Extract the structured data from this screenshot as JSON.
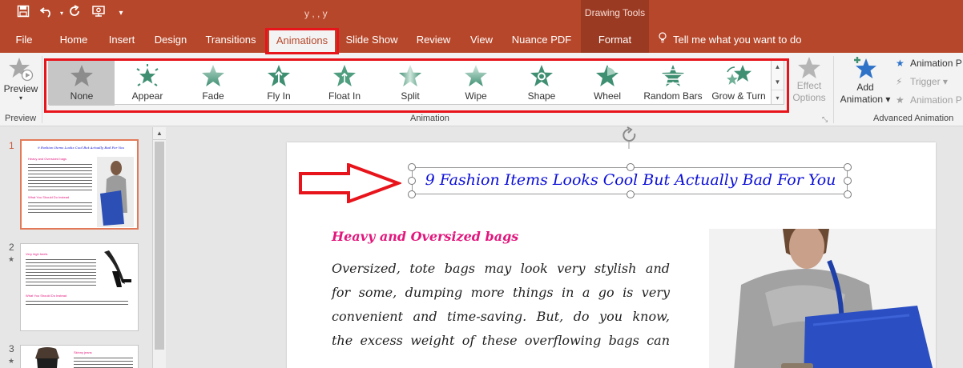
{
  "title_bar": {
    "document_title": "y                    ,   ,         y",
    "contextual_tab_group": "Drawing Tools",
    "quick_access": [
      "save-icon",
      "undo-icon",
      "redo-icon",
      "present-icon",
      "customize-icon"
    ]
  },
  "tabs": [
    {
      "label": "File"
    },
    {
      "label": "Home"
    },
    {
      "label": "Insert"
    },
    {
      "label": "Design"
    },
    {
      "label": "Transitions"
    },
    {
      "label": "Animations",
      "active": true
    },
    {
      "label": "Slide Show"
    },
    {
      "label": "Review"
    },
    {
      "label": "View"
    },
    {
      "label": "Nuance PDF"
    },
    {
      "label": "Format"
    }
  ],
  "tell_me": "Tell me what you want to do",
  "ribbon": {
    "preview": {
      "label": "Preview",
      "group": "Preview"
    },
    "animation_group": "Animation",
    "animations": [
      {
        "label": "None",
        "selected": true
      },
      {
        "label": "Appear"
      },
      {
        "label": "Fade"
      },
      {
        "label": "Fly In"
      },
      {
        "label": "Float In"
      },
      {
        "label": "Split"
      },
      {
        "label": "Wipe"
      },
      {
        "label": "Shape"
      },
      {
        "label": "Wheel"
      },
      {
        "label": "Random Bars"
      },
      {
        "label": "Grow & Turn"
      }
    ],
    "effect_options": {
      "line1": "Effect",
      "line2": "Options"
    },
    "add_animation": {
      "line1": "Add",
      "line2": "Animation"
    },
    "advanced_group": "Advanced Animation",
    "advanced_items": [
      {
        "label": "Animation P",
        "enabled": true
      },
      {
        "label": "Trigger",
        "enabled": false
      },
      {
        "label": "Animation P",
        "enabled": false
      }
    ]
  },
  "slides": [
    {
      "number": "1",
      "active": true,
      "title": "9 Fashion Items Looks Cool But Actually Bad For You",
      "heading": "Heavy and Oversized bags",
      "subheading": "What You Should Do Instead"
    },
    {
      "number": "2",
      "has_animation": true,
      "heading": "Very high heels",
      "subheading": "What You Should Do Instead"
    },
    {
      "number": "3",
      "has_animation": true,
      "heading": "Skinny jeans"
    }
  ],
  "slide": {
    "title": "9 Fashion Items Looks Cool But Actually Bad For You",
    "heading": "Heavy and Oversized bags",
    "body_lines": [
      "Oversized, tote bags may look very stylish and",
      "for some, dumping more things in a go is very",
      "convenient and time-saving. But, do you know,",
      "the excess weight of these overflowing bags can"
    ]
  },
  "colors": {
    "ribbon_bar": "#b7472a",
    "title_text": "#0b0ed8",
    "heading_text": "#e2177d",
    "highlight": "#e8141b",
    "star_green": "#3f8f72",
    "star_gray": "#9a9a9a"
  }
}
